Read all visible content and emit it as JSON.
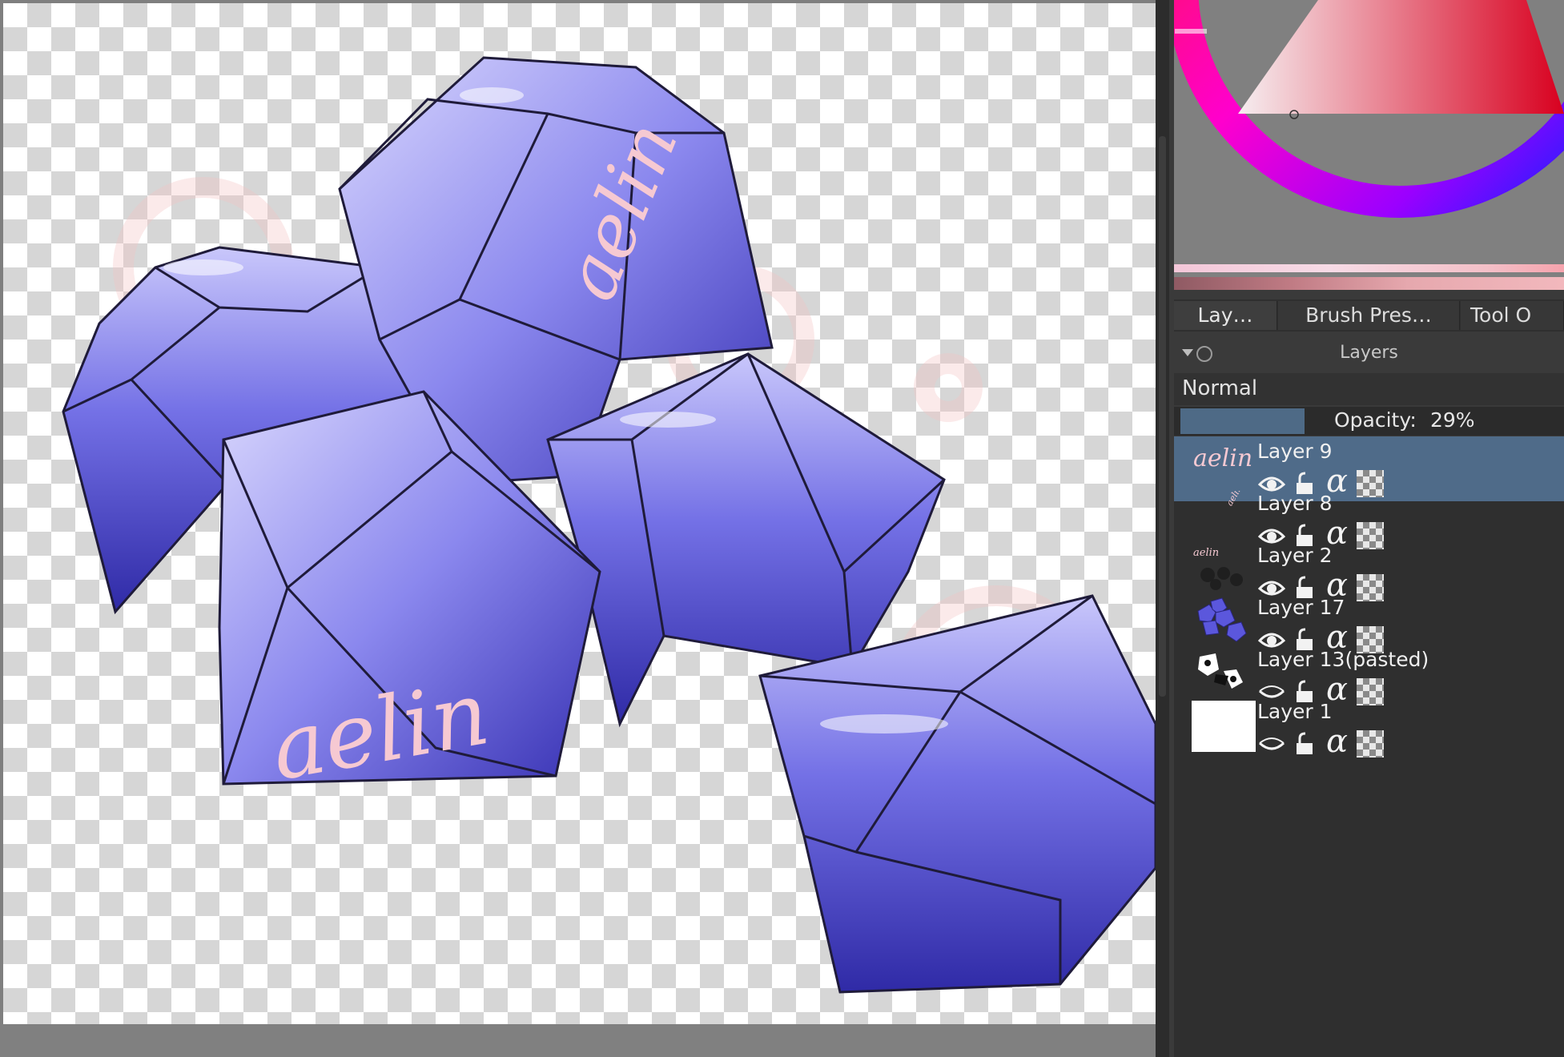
{
  "canvas": {
    "artwork_text": [
      "aelin",
      "aelin",
      "aelin"
    ]
  },
  "docker": {
    "tabs": [
      {
        "label": "Lay…",
        "active": true
      },
      {
        "label": "Brush Pres…",
        "active": false
      },
      {
        "label": "Tool O",
        "active": false
      }
    ],
    "layers_title": "Layers",
    "blend_mode": "Normal",
    "opacity_label": "Opacity:",
    "opacity_value": "29%",
    "opacity_fraction": 0.29
  },
  "layers": [
    {
      "name": "Layer 9",
      "selected": true,
      "visible": true
    },
    {
      "name": "Layer 8",
      "selected": false,
      "visible": true
    },
    {
      "name": "Layer 2",
      "selected": false,
      "visible": true
    },
    {
      "name": "Layer 17",
      "selected": false,
      "visible": true
    },
    {
      "name": "Layer 13(pasted)",
      "selected": false,
      "visible": false
    },
    {
      "name": "Layer 1",
      "selected": false,
      "visible": false
    }
  ],
  "colors": {
    "accent_selected": "#4f6b89",
    "gem_fill": "#5a55d8",
    "script_pink": "#f6c9d2"
  },
  "icons": [
    "eye-icon",
    "lock-icon",
    "alpha-lock-icon",
    "inherit-alpha-icon",
    "chevron-down-icon"
  ]
}
